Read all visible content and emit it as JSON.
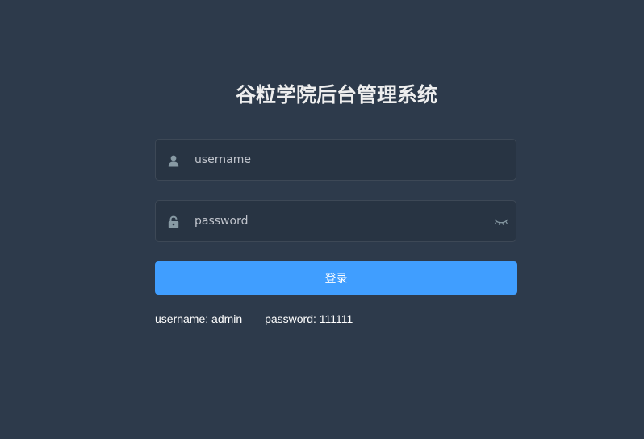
{
  "title": "谷粒学院后台管理系统",
  "username": {
    "placeholder": "username",
    "value": "",
    "icon": "user-icon"
  },
  "password": {
    "placeholder": "password",
    "value": "",
    "icon": "lock-icon",
    "toggle_icon": "eye-closed-icon"
  },
  "login_button": {
    "label": "登录"
  },
  "tips": {
    "username": "username: admin",
    "password": "password: 111111"
  },
  "colors": {
    "background": "#2d3a4b",
    "input_background": "#283443",
    "accent": "#409eff",
    "title": "#eeeeee",
    "icon": "#889aa4"
  }
}
